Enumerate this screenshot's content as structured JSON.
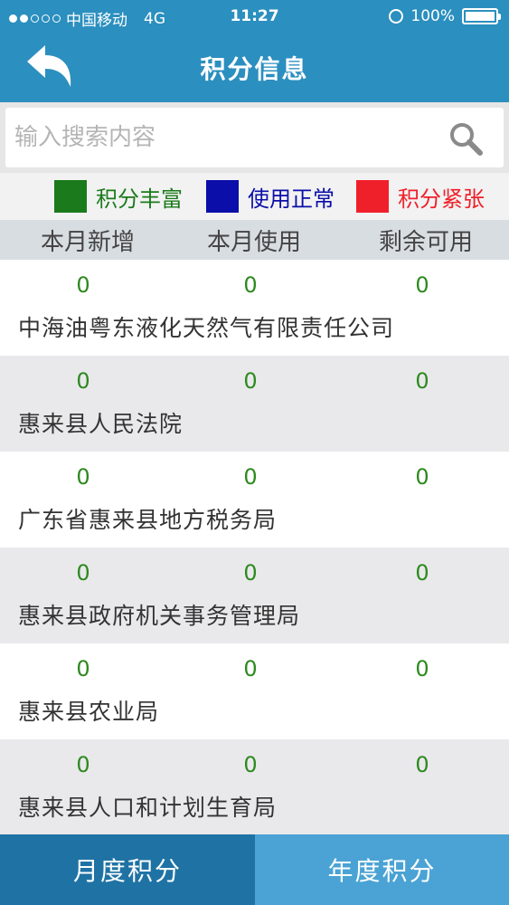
{
  "status_bar": {
    "carrier": "中国移动",
    "network": "4G",
    "time": "11:27",
    "battery": "100%"
  },
  "header": {
    "title": "积分信息"
  },
  "search": {
    "placeholder": "输入搜索内容"
  },
  "legend": [
    {
      "label": "积分丰富",
      "color": "#1b7a1b"
    },
    {
      "label": "使用正常",
      "color": "#0b0ea8"
    },
    {
      "label": "积分紧张",
      "color": "#f0202a"
    }
  ],
  "columns": [
    "本月新增",
    "本月使用",
    "剩余可用"
  ],
  "rows": [
    {
      "values": [
        "0",
        "0",
        "0"
      ],
      "name": "中海油粤东液化天然气有限责任公司"
    },
    {
      "values": [
        "0",
        "0",
        "0"
      ],
      "name": "惠来县人民法院"
    },
    {
      "values": [
        "0",
        "0",
        "0"
      ],
      "name": "广东省惠来县地方税务局"
    },
    {
      "values": [
        "0",
        "0",
        "0"
      ],
      "name": "惠来县政府机关事务管理局"
    },
    {
      "values": [
        "0",
        "0",
        "0"
      ],
      "name": "惠来县农业局"
    },
    {
      "values": [
        "0",
        "0",
        "0"
      ],
      "name": "惠来县人口和计划生育局"
    }
  ],
  "tabs": [
    {
      "label": "月度积分"
    },
    {
      "label": "年度积分"
    }
  ]
}
